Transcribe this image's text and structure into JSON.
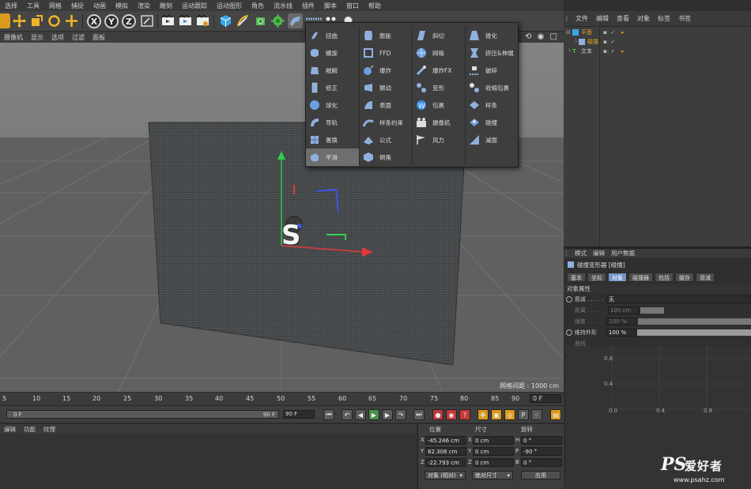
{
  "menubar": {
    "items": [
      "选择",
      "工具",
      "网格",
      "捕捉",
      "动画",
      "模拟",
      "渲染",
      "雕刻",
      "运动跟踪",
      "运动图形",
      "角色",
      "流水线",
      "插件",
      "脚本",
      "窗口",
      "帮助"
    ]
  },
  "viewport_menu": {
    "items": [
      "摄像机",
      "显示",
      "选项",
      "过滤",
      "面板"
    ],
    "nav_icons": "✥ ⟲ ◉ □"
  },
  "toolbar": {
    "axis_x": "X",
    "axis_y": "Y",
    "axis_z": "Z"
  },
  "deformer_menu": {
    "columns": [
      [
        "扭曲",
        "螺旋",
        "融解",
        "修正",
        "球化",
        "导轨",
        "置换",
        "平滑"
      ],
      [
        "膨胀",
        "FFD",
        "爆炸",
        "颤动",
        "表面",
        "样条约束",
        "公式",
        "倒角"
      ],
      [
        "斜切",
        "网格",
        "爆炸FX",
        "变形",
        "包裹",
        "摄像机",
        "风力"
      ],
      [
        "锥化",
        "挤压&伸展",
        "破碎",
        "收缩包裹",
        "样条",
        "碰撞",
        "减面"
      ]
    ],
    "selected": "平滑"
  },
  "viewport": {
    "grid_spacing": "网格间距 : 1000 cm",
    "object_glyph": "S"
  },
  "object_manager": {
    "menu": [
      "文件",
      "编辑",
      "查看",
      "对象",
      "标签",
      "书签"
    ],
    "tree": [
      {
        "name": "平面",
        "indent": 0
      },
      {
        "name": "碰撞",
        "indent": 1
      },
      {
        "name": "文本",
        "indent": 0
      }
    ]
  },
  "attribute_manager": {
    "menu": [
      "模式",
      "编辑",
      "用户数据"
    ],
    "title": "碰撞变形器 [碰撞]",
    "tabs": [
      "基本",
      "坐标",
      "对象",
      "碰撞器",
      "包括",
      "缓存",
      "衰减"
    ],
    "active_tab": "对象",
    "section": "对象属性",
    "rows": [
      {
        "label": "衰减 . . . . .",
        "value": "无",
        "enabled": true
      },
      {
        "label": "距离 . . . . .",
        "value": "100 cm",
        "enabled": false
      },
      {
        "label": "强度 . . . . .",
        "value": "100 %",
        "enabled": false
      },
      {
        "label": "维持外形",
        "value": "100 %",
        "enabled": true
      },
      {
        "label": "曲线",
        "value": "",
        "enabled": false
      }
    ],
    "graph_y_ticks": [
      "0.8",
      "0.4"
    ],
    "graph_x_ticks": [
      "0.0",
      "0.4",
      "0.8"
    ]
  },
  "timeline": {
    "ticks": [
      "5",
      "10",
      "15",
      "20",
      "25",
      "30",
      "35",
      "40",
      "45",
      "50",
      "55",
      "60",
      "65",
      "70",
      "75",
      "80",
      "85",
      "90"
    ],
    "current_frame": "0 F",
    "start": "0 F",
    "end": "90 F",
    "end_field": "90 F"
  },
  "material_manager": {
    "menu": [
      "编辑",
      "功能",
      "纹理"
    ]
  },
  "coordinates": {
    "headers": [
      "位置",
      "尺寸",
      "旋转"
    ],
    "rows": [
      {
        "pos_axis": "X",
        "pos": "-45.246 cm",
        "size_axis": "X",
        "size": "0 cm",
        "rot_axis": "H",
        "rot": "0 °"
      },
      {
        "pos_axis": "Y",
        "pos": "82.308 cm",
        "size_axis": "Y",
        "size": "0 cm",
        "rot_axis": "P",
        "rot": "-90 °"
      },
      {
        "pos_axis": "Z",
        "pos": "-22.793 cm",
        "size_axis": "Z",
        "size": "0 cm",
        "rot_axis": "B",
        "rot": "0 °"
      }
    ],
    "mode_select": "对象 (相对)",
    "size_select": "绝对尺寸",
    "apply_button": "应用"
  },
  "watermark": {
    "ps": "PS",
    "cn": "爱好者",
    "url": "www.psahz.com"
  },
  "colors": {
    "accent": "#d99a1e",
    "tab_active": "#7296c8",
    "gizmo_x": "#e23a3a",
    "gizmo_y": "#2fd04a",
    "gizmo_z": "#3a58e2"
  }
}
